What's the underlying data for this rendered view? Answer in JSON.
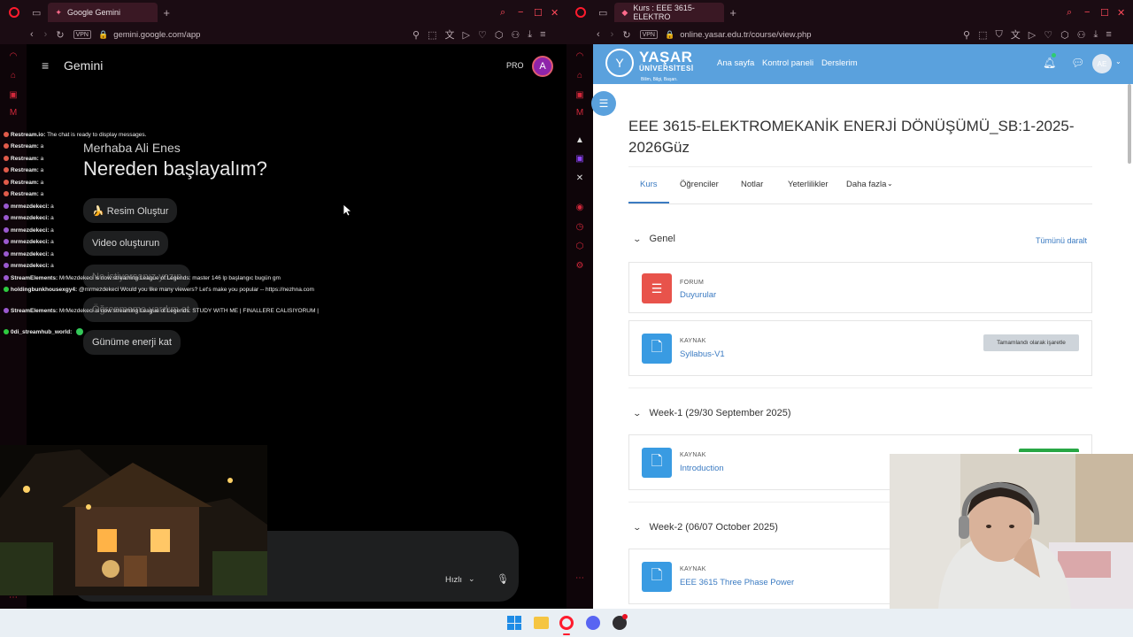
{
  "left": {
    "tab_title": "Google Gemini",
    "url": "gemini.google.com/app",
    "vpn": "VPN",
    "app_title": "Gemini",
    "pro_badge": "PRO",
    "avatar_letter": "A",
    "greeting": "Merhaba Ali Enes",
    "headline": "Nereden başlayalım?",
    "chips": [
      "🍌 Resim Oluştur",
      "Video oluşturun",
      "Ne istiyorsanız yazın",
      "Öğrenmeme yardım et",
      "Günüme enerji kat"
    ],
    "input_mode": "Hızlı"
  },
  "chat_overlay": [
    {
      "user": "Restream.io:",
      "msg": "The chat is ready to display messages."
    },
    {
      "user": "Restream:",
      "msg": "a"
    },
    {
      "user": "Restream:",
      "msg": "a"
    },
    {
      "user": "Restream:",
      "msg": "a"
    },
    {
      "user": "Restream:",
      "msg": "a"
    },
    {
      "user": "Restream:",
      "msg": "a"
    },
    {
      "user": "mrmezdekeci:",
      "msg": "a"
    },
    {
      "user": "mrmezdekeci:",
      "msg": "a"
    },
    {
      "user": "mrmezdekeci:",
      "msg": "a"
    },
    {
      "user": "mrmezdekeci:",
      "msg": "a"
    },
    {
      "user": "mrmezdekeci:",
      "msg": "a"
    },
    {
      "user": "mrmezdekeci:",
      "msg": "a"
    },
    {
      "user": "StreamElements:",
      "msg": "MrMezdekeci is now streaming League of Legends: master 146 lp başlangıc bugün gm"
    },
    {
      "user": "holdingbunkhousexgy4:",
      "msg": "@mrmezdekeci Would you like many viewers? Let's make you popular -- https://nezhna.com"
    },
    {
      "user": "StreamElements:",
      "msg": "MrMezdekeci is now streaming League of Legends: STUDY WITH ME | FINALLERE CALISIYORUM |"
    },
    {
      "user": "0di_streamhub_world:",
      "msg": ""
    }
  ],
  "right": {
    "tab_title": "Kurs : EEE 3615-ELEKTRO",
    "url": "online.yasar.edu.tr/course/view.php",
    "vpn": "VPN",
    "logo_main": "YAŞAR",
    "logo_sub": "ÜNİVERSİTESİ",
    "logo_tagline": "Bilim, Bilgi, Başarı.",
    "nav": [
      "Ana sayfa",
      "Kontrol paneli",
      "Derslerim"
    ],
    "user_initials": "AE",
    "course_title": "EEE 3615-ELEKTROMEKANİK ENERJİ DÖNÜŞÜMÜ_SB:1-2025-2026Güz",
    "tabs": [
      "Kurs",
      "Öğrenciler",
      "Notlar",
      "Yeterlilikler",
      "Daha fazla"
    ],
    "collapse_all": "Tümünü daralt",
    "sections": [
      {
        "title": "Genel"
      },
      {
        "title": "Week-1 (29/30 September 2025)"
      },
      {
        "title": "Week-2 (06/07 October 2025)"
      }
    ],
    "activities": [
      {
        "type": "FORUM",
        "name": "Duyurular"
      },
      {
        "type": "KAYNAK",
        "name": "Syllabus-V1",
        "action": "Tamamlandı olarak işaretle"
      },
      {
        "type": "KAYNAK",
        "name": "Introduction"
      },
      {
        "type": "KAYNAK",
        "name": "EEE 3615 Three Phase Power"
      }
    ]
  },
  "colors": {
    "accent_red": "#ff1b2d",
    "moodle_blue": "#5aa1dd",
    "link": "#3b7bc2",
    "forum_red": "#e8534b"
  }
}
